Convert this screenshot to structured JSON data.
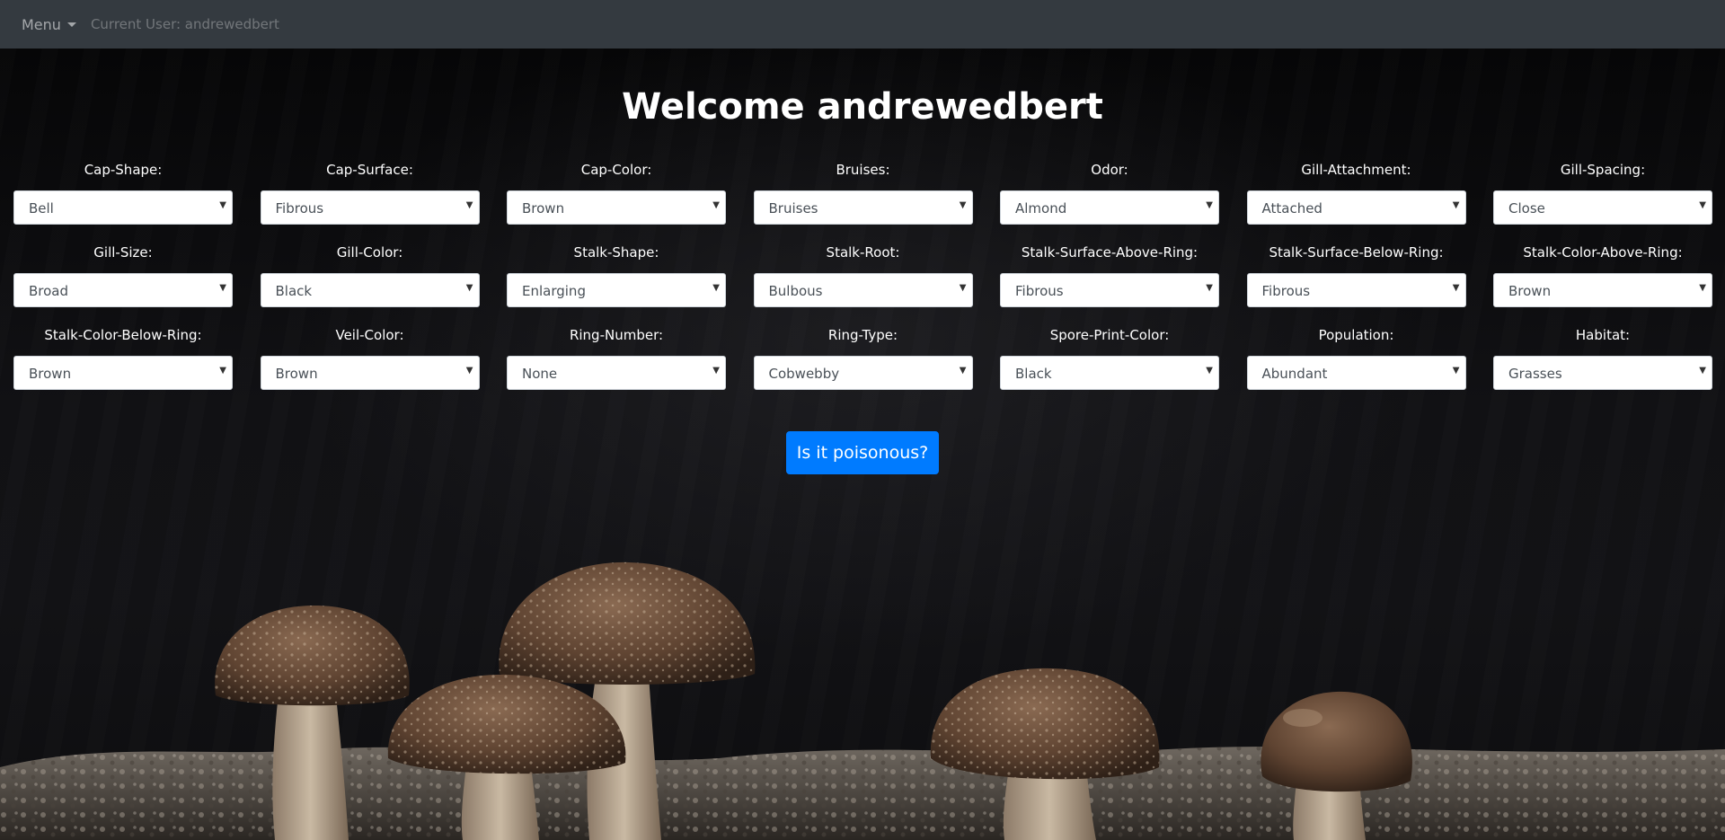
{
  "nav": {
    "menu_label": "Menu",
    "current_user_text": "Current User: andrewedbert"
  },
  "main": {
    "title": "Welcome andrewedbert",
    "submit_label": "Is it poisonous?"
  },
  "fields": [
    {
      "label": "Cap-Shape:",
      "value": "Bell"
    },
    {
      "label": "Cap-Surface:",
      "value": "Fibrous"
    },
    {
      "label": "Cap-Color:",
      "value": "Brown"
    },
    {
      "label": "Bruises:",
      "value": "Bruises"
    },
    {
      "label": "Odor:",
      "value": "Almond"
    },
    {
      "label": "Gill-Attachment:",
      "value": "Attached"
    },
    {
      "label": "Gill-Spacing:",
      "value": "Close"
    },
    {
      "label": "Gill-Size:",
      "value": "Broad"
    },
    {
      "label": "Gill-Color:",
      "value": "Black"
    },
    {
      "label": "Stalk-Shape:",
      "value": "Enlarging"
    },
    {
      "label": "Stalk-Root:",
      "value": "Bulbous"
    },
    {
      "label": "Stalk-Surface-Above-Ring:",
      "value": "Fibrous"
    },
    {
      "label": "Stalk-Surface-Below-Ring:",
      "value": "Fibrous"
    },
    {
      "label": "Stalk-Color-Above-Ring:",
      "value": "Brown"
    },
    {
      "label": "Stalk-Color-Below-Ring:",
      "value": "Brown"
    },
    {
      "label": "Veil-Color:",
      "value": "Brown"
    },
    {
      "label": "Ring-Number:",
      "value": "None"
    },
    {
      "label": "Ring-Type:",
      "value": "Cobwebby"
    },
    {
      "label": "Spore-Print-Color:",
      "value": "Black"
    },
    {
      "label": "Population:",
      "value": "Abundant"
    },
    {
      "label": "Habitat:",
      "value": "Grasses"
    }
  ],
  "colors": {
    "navbar": "#343a40",
    "primary_button": "#007bff",
    "background": "#0a0a0b"
  }
}
